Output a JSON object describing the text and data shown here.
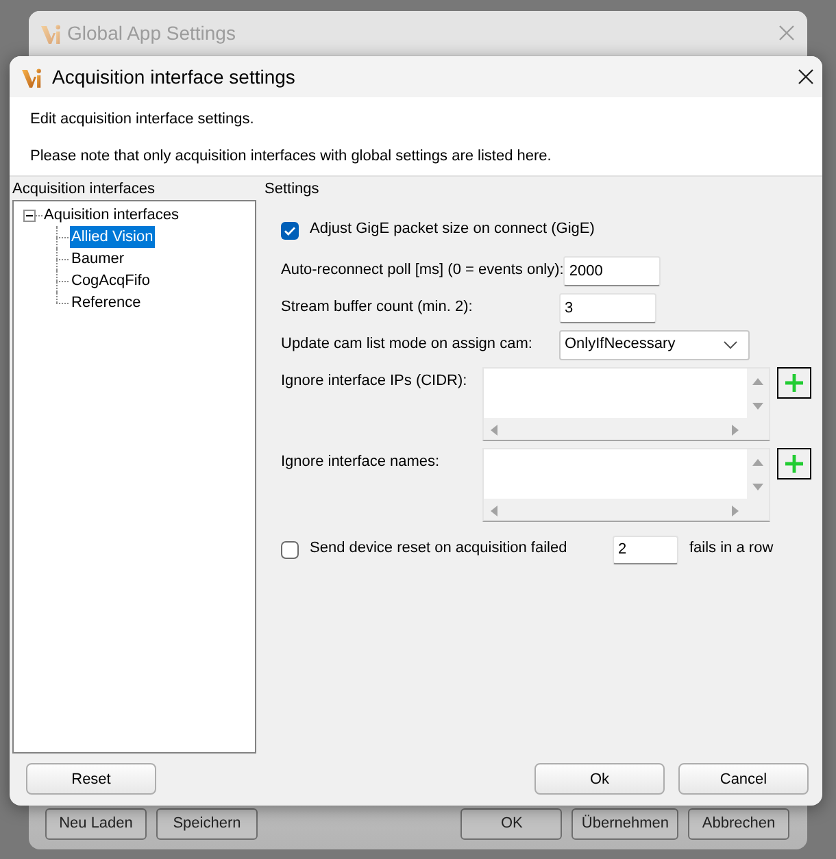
{
  "background_window": {
    "title": "Global App Settings",
    "left_buttons": [
      "Neu Laden",
      "Speichern"
    ],
    "right_buttons": [
      "OK",
      "Übernehmen",
      "Abbrechen"
    ]
  },
  "dialog": {
    "title": "Acquisition interface settings",
    "notes": [
      "Edit acquisition interface settings.",
      "Please note that only acquisition interfaces with global settings are listed here."
    ]
  },
  "interfaces_panel": {
    "label": "Acquisition interfaces",
    "tree": [
      {
        "label": "Aquisition interfaces",
        "expanded": true,
        "selected": false,
        "children": [
          {
            "label": "Allied Vision",
            "selected": true
          },
          {
            "label": "Baumer",
            "selected": false
          },
          {
            "label": "CogAcqFifo",
            "selected": false
          },
          {
            "label": "Reference",
            "selected": false
          }
        ]
      }
    ]
  },
  "settings_panel": {
    "label": "Settings",
    "rows": [
      {
        "kind": "checkbox",
        "label": "Adjust GigE packet size on connect (GigE)",
        "checked": true
      },
      {
        "kind": "number",
        "label": "Auto-reconnect poll [ms] (0 = events only):",
        "value": "2000"
      },
      {
        "kind": "number",
        "label": "Stream buffer count (min. 2):",
        "value": "3"
      },
      {
        "kind": "dropdown",
        "label": "Update cam list mode on assign cam:",
        "value": "OnlyIfNecessary"
      },
      {
        "kind": "list",
        "label": "Ignore interface IPs (CIDR):"
      },
      {
        "kind": "list",
        "label": "Ignore interface names:"
      },
      {
        "kind": "checkbox_count",
        "label": "Send device reset on acquisition failed",
        "checked": false,
        "value": "2",
        "suffix": "fails in a row"
      }
    ]
  },
  "footer": {
    "left_buttons": [
      "Reset"
    ],
    "right_buttons": [
      "Ok",
      "Cancel"
    ]
  }
}
